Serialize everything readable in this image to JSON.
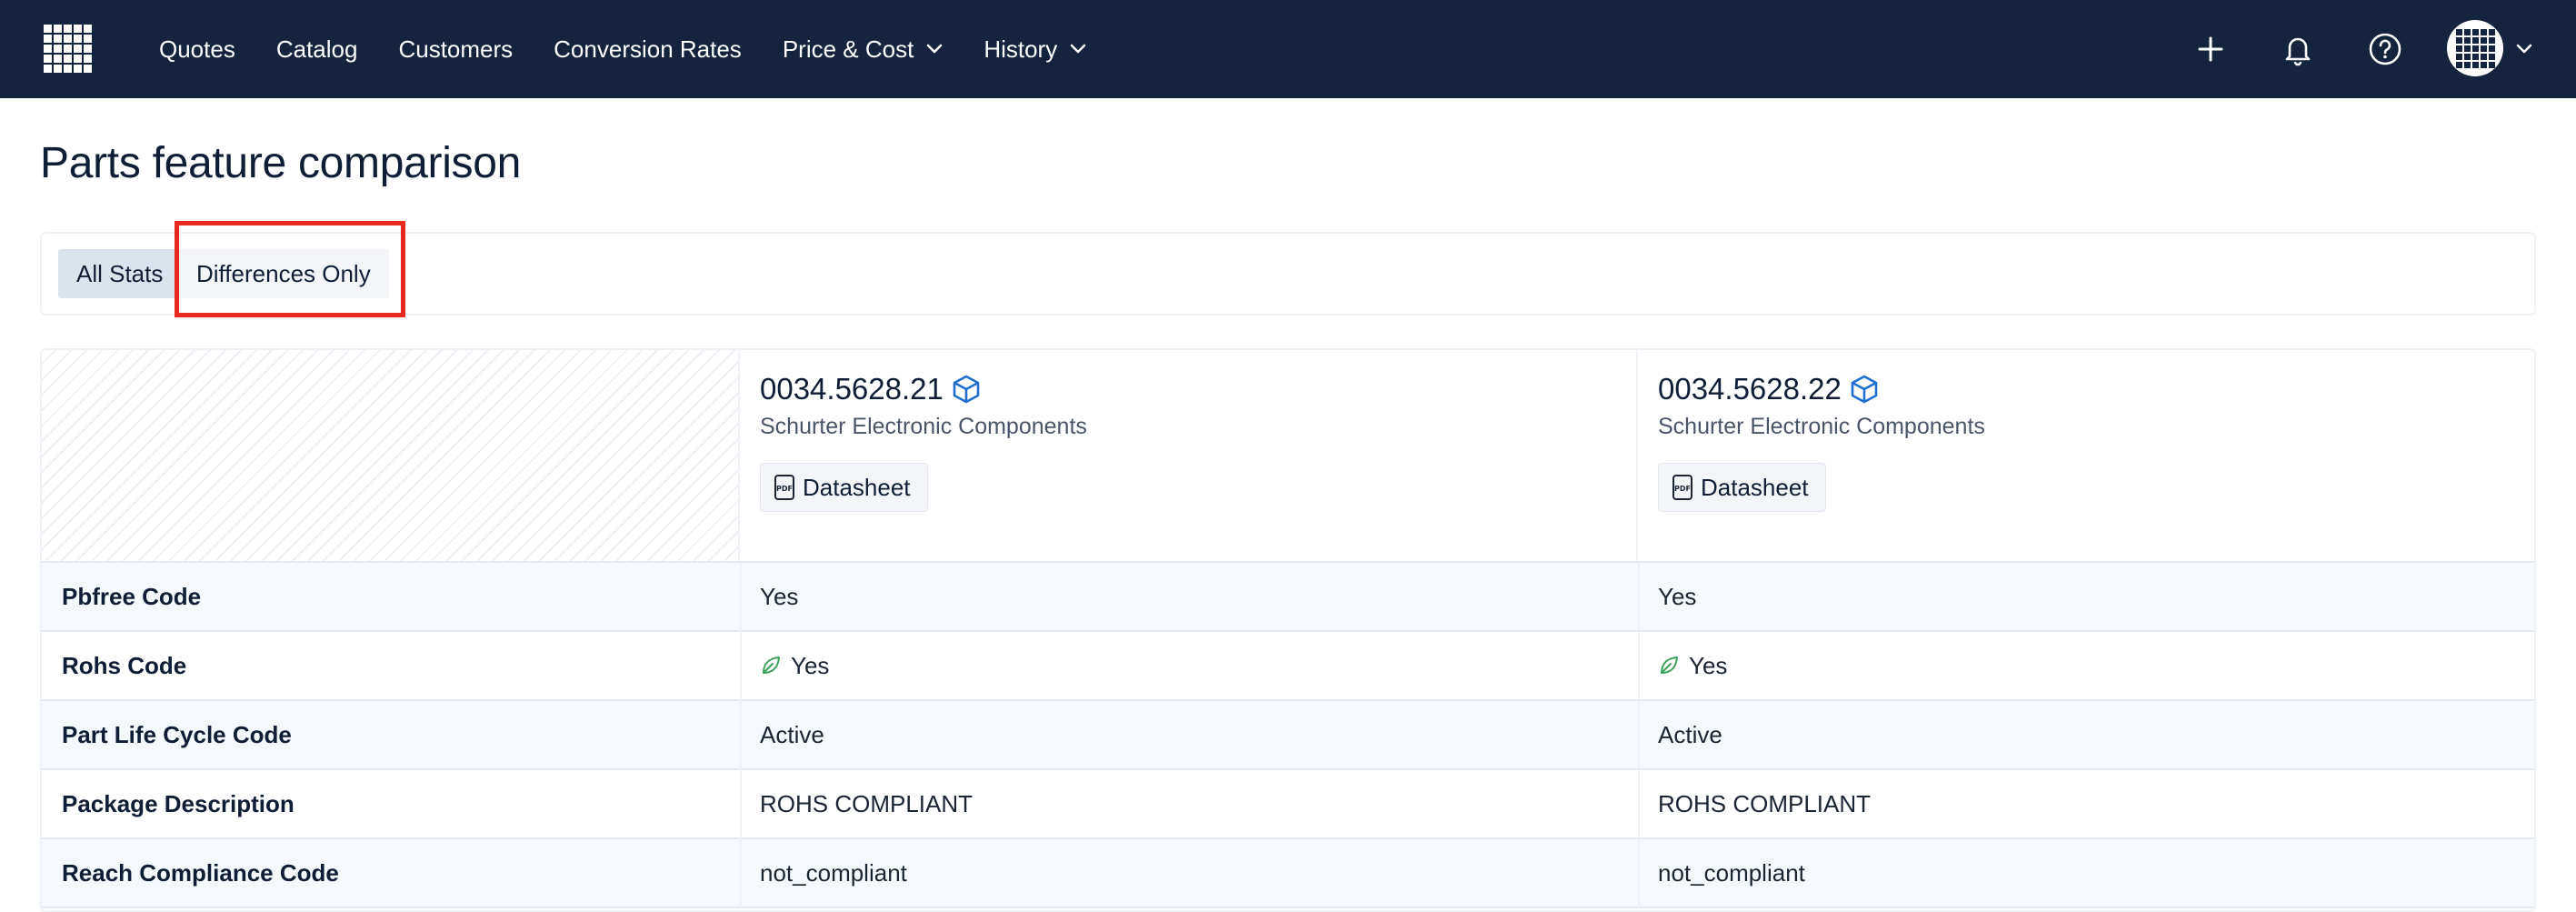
{
  "nav": {
    "links": [
      {
        "label": "Quotes"
      },
      {
        "label": "Catalog"
      },
      {
        "label": "Customers"
      },
      {
        "label": "Conversion Rates"
      },
      {
        "label": "Price & Cost",
        "has_dropdown": true
      },
      {
        "label": "History",
        "has_dropdown": true
      }
    ],
    "icons": [
      "plus-icon",
      "bell-icon",
      "help-icon",
      "avatar"
    ]
  },
  "page": {
    "title": "Parts feature comparison"
  },
  "filters": {
    "all_label": "All Stats",
    "diff_label": "Differences Only",
    "active": "All Stats"
  },
  "parts": [
    {
      "number": "0034.5628.21",
      "manufacturer": "Schurter Electronic Components",
      "datasheet_label": "Datasheet"
    },
    {
      "number": "0034.5628.22",
      "manufacturer": "Schurter Electronic Components",
      "datasheet_label": "Datasheet"
    }
  ],
  "rows": [
    {
      "label": "Pbfree Code",
      "values": [
        "Yes",
        "Yes"
      ]
    },
    {
      "label": "Rohs Code",
      "values": [
        "Yes",
        "Yes"
      ],
      "icon": "leaf-icon"
    },
    {
      "label": "Part Life Cycle Code",
      "values": [
        "Active",
        "Active"
      ]
    },
    {
      "label": "Package Description",
      "values": [
        "ROHS COMPLIANT",
        "ROHS COMPLIANT"
      ]
    },
    {
      "label": "Reach Compliance Code",
      "values": [
        "not_compliant",
        "not_compliant"
      ]
    }
  ],
  "colors": {
    "nav_bg": "#14243e",
    "accent_blue": "#1f6fd1",
    "highlight": "#e8281d",
    "leaf_green": "#3aa35a"
  }
}
